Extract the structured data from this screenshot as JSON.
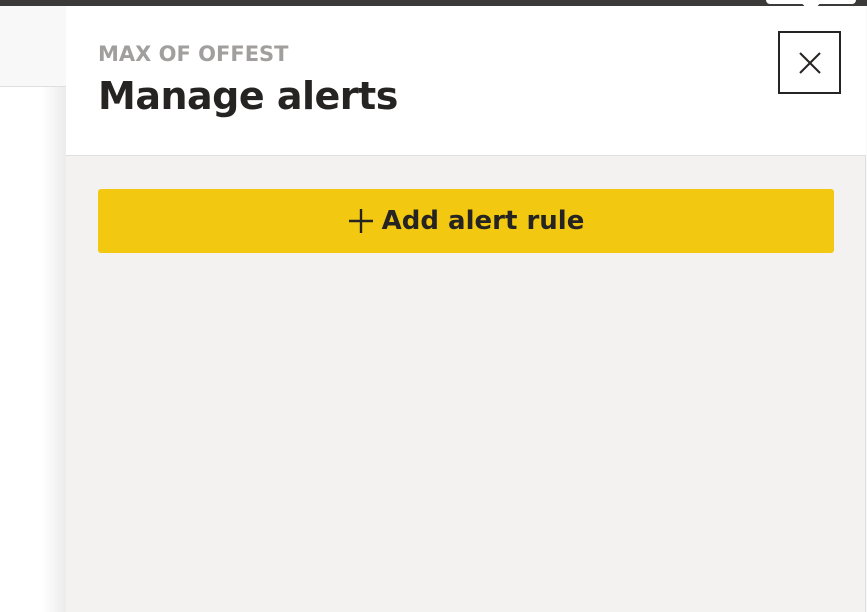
{
  "panel": {
    "subtitle": "MAX OF OFFEST",
    "title": "Manage alerts",
    "close_icon": "close-icon",
    "add_rule": {
      "label": "Add alert rule",
      "icon": "plus-icon"
    }
  },
  "colors": {
    "accent": "#f2c811",
    "title_text": "#252423",
    "subtitle_text": "#a19f9d",
    "panel_bg": "#f3f2f1",
    "topbar": "#3b3a39"
  }
}
